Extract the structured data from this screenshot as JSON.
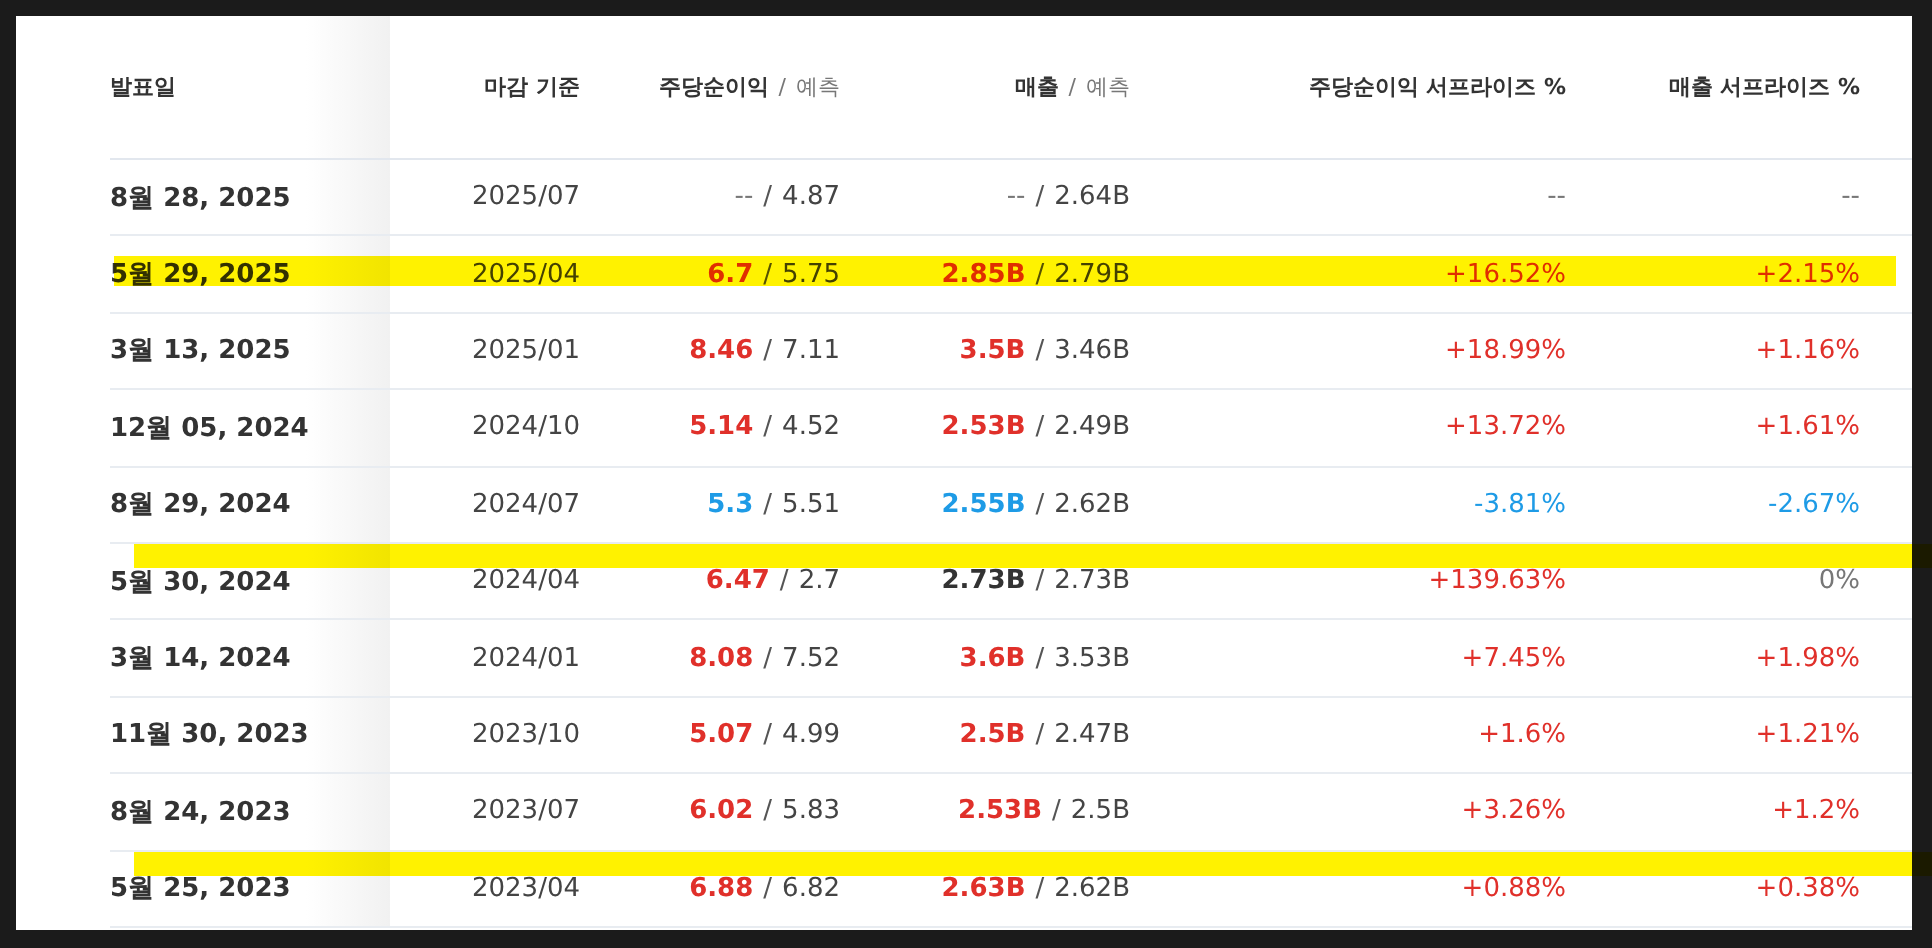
{
  "table": {
    "columns": [
      {
        "title": "발표일"
      },
      {
        "title": "마감 기준"
      },
      {
        "title": "주당순이익",
        "sep": "/",
        "sub": "예측"
      },
      {
        "title": "매출",
        "sep": "/",
        "sub": "예측"
      },
      {
        "title": "주당순이익 서프라이즈 %"
      },
      {
        "title": "매출 서프라이즈 %"
      }
    ],
    "rows": [
      {
        "date": "8월 28, 2025",
        "period": "2025/07",
        "eps": {
          "actual": "--",
          "sep": "/",
          "forecast": "4.87",
          "kind": "none"
        },
        "revenue": {
          "actual": "--",
          "sep": "/",
          "forecast": "2.64B",
          "kind": "none"
        },
        "eps_surprise": {
          "text": "--",
          "kind": "none"
        },
        "revenue_surprise": {
          "text": "--",
          "kind": "none"
        },
        "highlighted": false
      },
      {
        "date": "5월 29, 2025",
        "period": "2025/04",
        "eps": {
          "actual": "6.7",
          "sep": "/",
          "forecast": "5.75",
          "kind": "beat"
        },
        "revenue": {
          "actual": "2.85B",
          "sep": "/",
          "forecast": "2.79B",
          "kind": "beat"
        },
        "eps_surprise": {
          "text": "+16.52%",
          "kind": "beat"
        },
        "revenue_surprise": {
          "text": "+2.15%",
          "kind": "beat"
        },
        "highlighted": true,
        "marker_over_text": true
      },
      {
        "date": "3월 13, 2025",
        "period": "2025/01",
        "eps": {
          "actual": "8.46",
          "sep": "/",
          "forecast": "7.11",
          "kind": "beat"
        },
        "revenue": {
          "actual": "3.5B",
          "sep": "/",
          "forecast": "3.46B",
          "kind": "beat"
        },
        "eps_surprise": {
          "text": "+18.99%",
          "kind": "beat"
        },
        "revenue_surprise": {
          "text": "+1.16%",
          "kind": "beat"
        },
        "highlighted": false
      },
      {
        "date": "12월 05, 2024",
        "period": "2024/10",
        "eps": {
          "actual": "5.14",
          "sep": "/",
          "forecast": "4.52",
          "kind": "beat"
        },
        "revenue": {
          "actual": "2.53B",
          "sep": "/",
          "forecast": "2.49B",
          "kind": "beat"
        },
        "eps_surprise": {
          "text": "+13.72%",
          "kind": "beat"
        },
        "revenue_surprise": {
          "text": "+1.61%",
          "kind": "beat"
        },
        "highlighted": false
      },
      {
        "date": "8월 29, 2024",
        "period": "2024/07",
        "eps": {
          "actual": "5.3",
          "sep": "/",
          "forecast": "5.51",
          "kind": "miss"
        },
        "revenue": {
          "actual": "2.55B",
          "sep": "/",
          "forecast": "2.62B",
          "kind": "miss"
        },
        "eps_surprise": {
          "text": "-3.81%",
          "kind": "miss"
        },
        "revenue_surprise": {
          "text": "-2.67%",
          "kind": "miss"
        },
        "highlighted": false
      },
      {
        "date": "5월 30, 2024",
        "period": "2024/04",
        "eps": {
          "actual": "6.47",
          "sep": "/",
          "forecast": "2.7",
          "kind": "beat"
        },
        "revenue": {
          "actual": "2.73B",
          "sep": "/",
          "forecast": "2.73B",
          "kind": "even"
        },
        "eps_surprise": {
          "text": "+139.63%",
          "kind": "beat"
        },
        "revenue_surprise": {
          "text": "0%",
          "kind": "none"
        },
        "highlighted": true,
        "marker_over_text": false
      },
      {
        "date": "3월 14, 2024",
        "period": "2024/01",
        "eps": {
          "actual": "8.08",
          "sep": "/",
          "forecast": "7.52",
          "kind": "beat"
        },
        "revenue": {
          "actual": "3.6B",
          "sep": "/",
          "forecast": "3.53B",
          "kind": "beat"
        },
        "eps_surprise": {
          "text": "+7.45%",
          "kind": "beat"
        },
        "revenue_surprise": {
          "text": "+1.98%",
          "kind": "beat"
        },
        "highlighted": false
      },
      {
        "date": "11월 30, 2023",
        "period": "2023/10",
        "eps": {
          "actual": "5.07",
          "sep": "/",
          "forecast": "4.99",
          "kind": "beat"
        },
        "revenue": {
          "actual": "2.5B",
          "sep": "/",
          "forecast": "2.47B",
          "kind": "beat"
        },
        "eps_surprise": {
          "text": "+1.6%",
          "kind": "beat"
        },
        "revenue_surprise": {
          "text": "+1.21%",
          "kind": "beat"
        },
        "highlighted": false
      },
      {
        "date": "8월 24, 2023",
        "period": "2023/07",
        "eps": {
          "actual": "6.02",
          "sep": "/",
          "forecast": "5.83",
          "kind": "beat"
        },
        "revenue": {
          "actual": "2.53B",
          "sep": "/",
          "forecast": "2.5B",
          "kind": "beat"
        },
        "eps_surprise": {
          "text": "+3.26%",
          "kind": "beat"
        },
        "revenue_surprise": {
          "text": "+1.2%",
          "kind": "beat"
        },
        "highlighted": false
      },
      {
        "date": "5월 25, 2023",
        "period": "2023/04",
        "eps": {
          "actual": "6.88",
          "sep": "/",
          "forecast": "6.82",
          "kind": "beat"
        },
        "revenue": {
          "actual": "2.63B",
          "sep": "/",
          "forecast": "2.62B",
          "kind": "beat"
        },
        "eps_surprise": {
          "text": "+0.88%",
          "kind": "beat"
        },
        "revenue_surprise": {
          "text": "+0.38%",
          "kind": "beat"
        },
        "highlighted": true,
        "marker_over_text": false
      }
    ]
  }
}
